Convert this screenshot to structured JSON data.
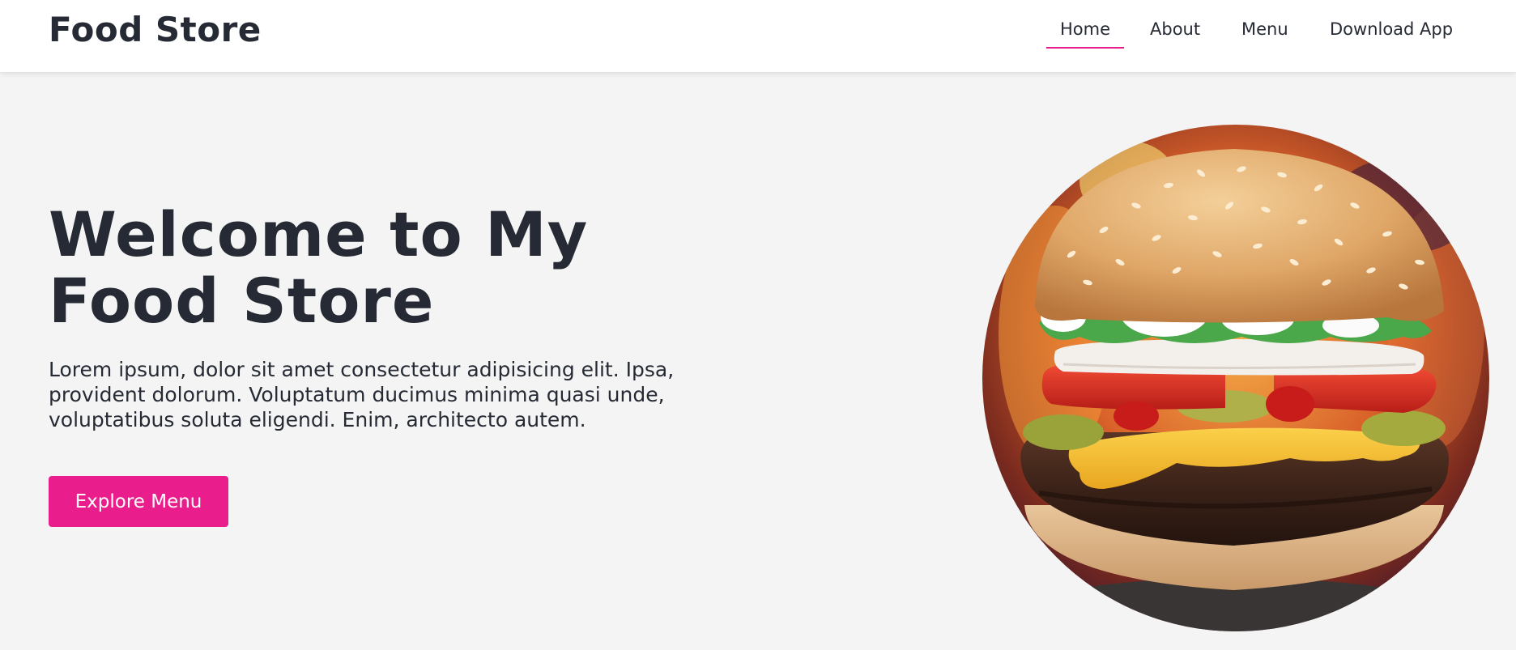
{
  "brand": {
    "name": "Food Store"
  },
  "nav": {
    "items": [
      {
        "label": "Home",
        "active": true
      },
      {
        "label": "About",
        "active": false
      },
      {
        "label": "Menu",
        "active": false
      },
      {
        "label": "Download App",
        "active": false
      }
    ]
  },
  "hero": {
    "title": "Welcome to My Food Store",
    "description": "Lorem ipsum, dolor sit amet consectetur adipisicing elit. Ipsa, provident dolorum. Voluptatum ducimus minima quasi unde, voluptatibus soluta eligendi. Enim, architecto autem.",
    "cta_label": "Explore Menu",
    "image_subject": "burger"
  },
  "colors": {
    "accent": "#e91e8c",
    "text": "#252a34",
    "background": "#f4f4f4",
    "navbar": "#ffffff"
  }
}
